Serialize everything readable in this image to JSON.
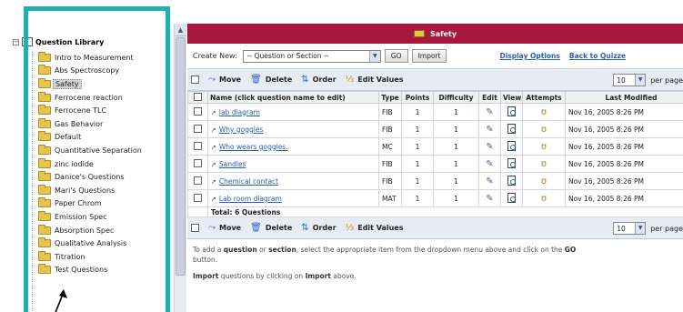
{
  "sidebar": {
    "root_label": "Question Library",
    "items": [
      {
        "label": "Intro to Measurement",
        "selected": false
      },
      {
        "label": "Abs Spectroscopy",
        "selected": false
      },
      {
        "label": "Safety",
        "selected": true
      },
      {
        "label": "Ferrocene reaction",
        "selected": false
      },
      {
        "label": "Ferrocene TLC",
        "selected": false
      },
      {
        "label": "Gas Behavior",
        "selected": false
      },
      {
        "label": "Default",
        "selected": false
      },
      {
        "label": "Quantitative Separation",
        "selected": false
      },
      {
        "label": "zinc iodide",
        "selected": false
      },
      {
        "label": "Danice's Questions",
        "selected": false
      },
      {
        "label": "Mari's Questions",
        "selected": false
      },
      {
        "label": "Paper Chrom",
        "selected": false
      },
      {
        "label": "Emission Spec",
        "selected": false
      },
      {
        "label": "Absorption Spec",
        "selected": false
      },
      {
        "label": "Qualitative Analysis",
        "selected": false
      },
      {
        "label": "Titration",
        "selected": false
      },
      {
        "label": "Test Questions",
        "selected": false
      }
    ]
  },
  "main": {
    "title": "Safety",
    "create_label": "Create New:",
    "create_select_value": "-- Question or Section --",
    "go_label": "GO",
    "import_label": "Import",
    "display_options_label": "Display Options",
    "back_label": "Back to Quizze",
    "toolbar": {
      "move": "Move",
      "delete": "Delete",
      "order": "Order",
      "edit_values": "Edit Values",
      "per_page_value": "10",
      "per_page_label": "per page"
    },
    "table": {
      "headers": [
        "Name (click question name to edit)",
        "Type",
        "Points",
        "Difficulty",
        "Edit",
        "View",
        "Attempts",
        "Last Modified"
      ],
      "rows": [
        {
          "name": "lab diagram",
          "type": "FIB",
          "points": "1",
          "difficulty": "1",
          "modified": "Nov 16, 2005 8:26 PM"
        },
        {
          "name": "Why goggles",
          "type": "FIB",
          "points": "1",
          "difficulty": "1",
          "modified": "Nov 16, 2005 8:26 PM"
        },
        {
          "name": "Who wears goggles.",
          "type": "MC",
          "points": "1",
          "difficulty": "1",
          "modified": "Nov 16, 2005 8:26 PM"
        },
        {
          "name": "Sandles",
          "type": "FIB",
          "points": "1",
          "difficulty": "1",
          "modified": "Nov 16, 2005 8:26 PM"
        },
        {
          "name": "Chemical contact",
          "type": "FIB",
          "points": "1",
          "difficulty": "1",
          "modified": "Nov 16, 2005 8:26 PM"
        },
        {
          "name": "Lab room diagram",
          "type": "MAT",
          "points": "1",
          "difficulty": "1",
          "modified": "Nov 16, 2005 8:26 PM"
        }
      ],
      "total": "Total: 6 Questions"
    },
    "help": {
      "line1_a": "To add a ",
      "line1_b": "question",
      "line1_c": " or ",
      "line1_d": "section",
      "line1_e": ", select the appropriate item from the dropdown menu above and click on the ",
      "line1_f": "GO",
      "line1_g": "button.",
      "line2_a": "Import",
      "line2_b": " questions by clicking on ",
      "line2_c": "Import",
      "line2_d": " above."
    }
  },
  "colors": {
    "title_bar": "#a8183e",
    "highlight_box": "#1cb0b1",
    "link": "#2a5db0",
    "toolbar_bg": "#e7ebf4"
  },
  "icons": [
    "book-icon",
    "folder-icon",
    "move-icon",
    "delete-icon",
    "order-icon",
    "edit-values-icon",
    "edit-icon",
    "view-icon",
    "attempts-icon",
    "annotation-arrow"
  ]
}
